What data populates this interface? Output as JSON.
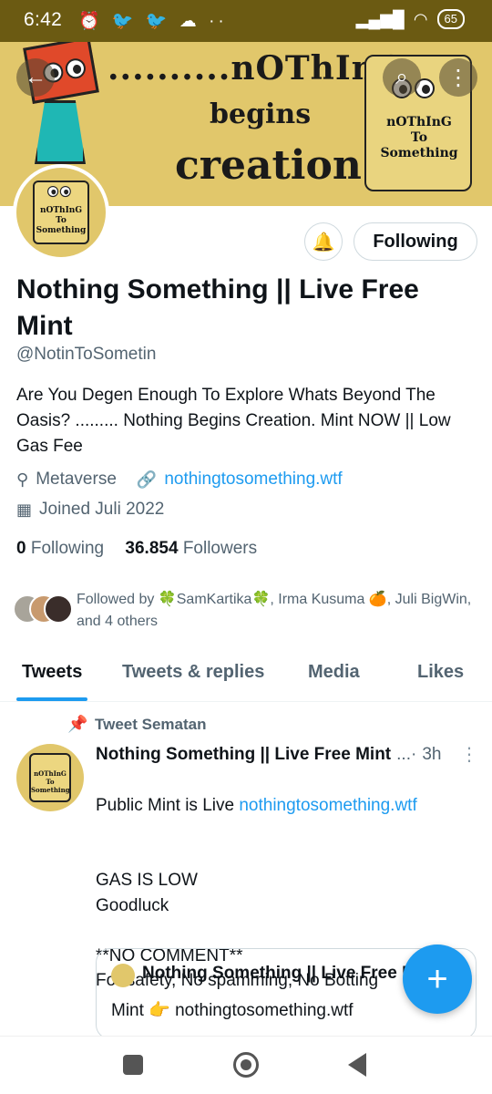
{
  "status_bar": {
    "time": "6:42",
    "icons": "⏰ 🐦 🐦 ☁ ··",
    "signal": "▂▄▆█",
    "battery": "65"
  },
  "banner": {
    "line1": "..........nOThInG",
    "line2": "begins",
    "line3": "creation",
    "scroll_text": "nOThInG\nTo\nSomething"
  },
  "avatar_text": "nOThInG\nTo\nSomething",
  "profile": {
    "follow_button": "Following",
    "display_name": "Nothing Something || Live Free Mint",
    "handle": "@NotinToSometin",
    "bio": "Are You Degen Enough To Explore Whats Beyond The Oasis?  ......... Nothing Begins Creation. Mint NOW || Low Gas Fee",
    "location": "Metaverse",
    "website": "nothingtosomething.wtf",
    "joined": "Joined Juli 2022",
    "following_count": "0",
    "following_label": "Following",
    "followers_count": "36.854",
    "followers_label": "Followers",
    "followed_by": "Followed by 🍀SamKartika🍀, Irma Kusuma 🍊, Juli BigWin, and 4 others"
  },
  "tabs": [
    "Tweets",
    "Tweets & replies",
    "Media",
    "Likes"
  ],
  "pinned_label": "Tweet Sematan",
  "tweet": {
    "name": "Nothing Something || Live Free Mint",
    "dots": "...·",
    "time": "3h",
    "body_prefix": "Public Mint is Live ",
    "body_link": "nothingtosomething.wtf",
    "body_rest": "GAS IS LOW\nGoodluck\n\n**NO COMMENT**\nFor safety, No spamming, No Botting"
  },
  "quote": {
    "name": "Nothing Something || Live Free Mint",
    "text": "Mint 👉 nothingtosomething.wtf"
  },
  "colors": {
    "accent": "#1d9bf0",
    "banner": "#e1c76b",
    "statusbar": "#6b5a12"
  },
  "icons": {
    "back": "arrow-left-icon",
    "search": "search-icon",
    "more": "more-vertical-icon",
    "bell": "bell-plus-icon",
    "location": "location-pin-icon",
    "link": "link-icon",
    "calendar": "calendar-icon",
    "pin": "pin-icon",
    "compose": "plus-icon"
  }
}
